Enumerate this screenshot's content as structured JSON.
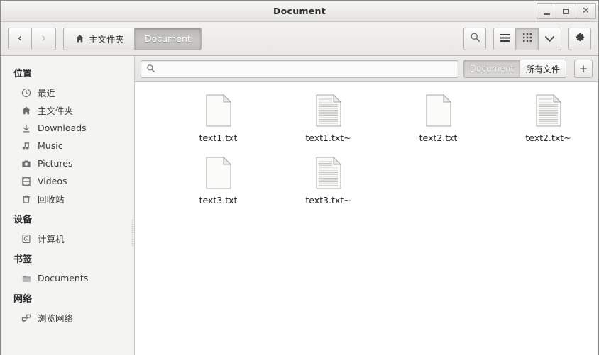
{
  "window": {
    "title": "Document",
    "controls": {
      "minimize": "_",
      "maximize": "□",
      "close": "✕"
    }
  },
  "toolbar": {
    "back_label": "‹",
    "forward_label": "›",
    "breadcrumbs": [
      {
        "label": "主文件夹",
        "icon": "home-icon",
        "active": false
      },
      {
        "label": "Document",
        "icon": null,
        "active": true
      }
    ],
    "buttons": [
      {
        "name": "search-toggle-button",
        "icon": "search-icon"
      },
      {
        "name": "list-view-button",
        "icon": "list-view-icon"
      },
      {
        "name": "grid-view-button",
        "icon": "grid-view-icon"
      },
      {
        "name": "view-options-button",
        "icon": "chevron-down-icon"
      },
      {
        "name": "settings-button",
        "icon": "gear-icon"
      }
    ]
  },
  "sidebar": {
    "sections": [
      {
        "header": "位置",
        "items": [
          {
            "label": "最近",
            "icon": "clock-icon"
          },
          {
            "label": "主文件夹",
            "icon": "home-icon"
          },
          {
            "label": "Downloads",
            "icon": "download-icon"
          },
          {
            "label": "Music",
            "icon": "music-note-icon"
          },
          {
            "label": "Pictures",
            "icon": "camera-icon"
          },
          {
            "label": "Videos",
            "icon": "film-icon"
          },
          {
            "label": "回收站",
            "icon": "trash-icon"
          }
        ]
      },
      {
        "header": "设备",
        "items": [
          {
            "label": "计算机",
            "icon": "computer-icon"
          }
        ]
      },
      {
        "header": "书签",
        "items": [
          {
            "label": "Documents",
            "icon": "folder-icon"
          }
        ]
      },
      {
        "header": "网络",
        "items": [
          {
            "label": "浏览网络",
            "icon": "network-icon"
          }
        ]
      }
    ]
  },
  "search": {
    "value": "",
    "placeholder": "",
    "icon": "search-icon"
  },
  "filter": {
    "tabs": [
      {
        "label": "Document",
        "active": false
      },
      {
        "label": "所有文件",
        "active": true
      }
    ],
    "add_label": "+"
  },
  "files": [
    {
      "name": "text1.txt",
      "type": "blank-document"
    },
    {
      "name": "text1.txt~",
      "type": "text-document"
    },
    {
      "name": "text2.txt",
      "type": "blank-document"
    },
    {
      "name": "text2.txt~",
      "type": "text-document"
    },
    {
      "name": "text3.txt",
      "type": "blank-document"
    },
    {
      "name": "text3.txt~",
      "type": "text-document"
    }
  ],
  "colors": {
    "window_chrome": "#eeedec",
    "sidebar_bg": "#f4f4f3",
    "content_bg": "#ffffff",
    "border": "#c6c5c2",
    "active_crumb": "#bfbebb",
    "text": "#2e2e2e"
  }
}
